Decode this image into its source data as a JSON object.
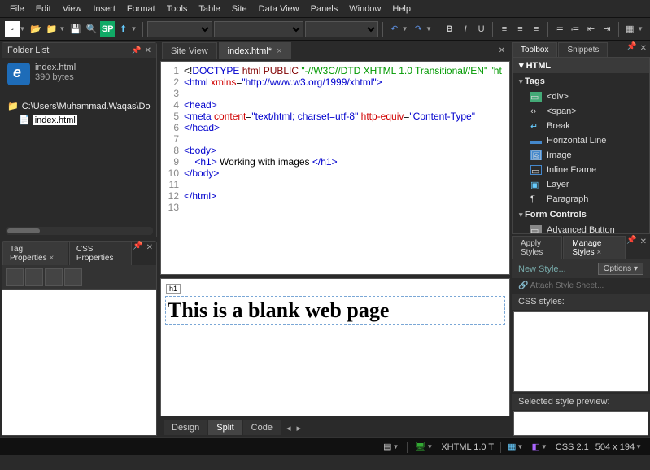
{
  "menu": [
    "File",
    "Edit",
    "View",
    "Insert",
    "Format",
    "Tools",
    "Table",
    "Site",
    "Data View",
    "Panels",
    "Window",
    "Help"
  ],
  "folder_panel": {
    "title": "Folder List",
    "file_name": "index.html",
    "file_size": "390 bytes",
    "path": "C:\\Users\\Muhammad.Waqas\\Documents\\M",
    "selected_file": "index.html"
  },
  "tag_panel": {
    "tab1": "Tag Properties",
    "tab2": "CSS Properties"
  },
  "doc_tabs": {
    "tab1": "Site View",
    "tab2": "index.html*"
  },
  "code_lines": [
    "<!DOCTYPE html PUBLIC \"-//W3C//DTD XHTML 1.0 Transitional//EN\" \"ht",
    "<html xmlns=\"http://www.w3.org/1999/xhtml\">",
    "",
    "<head>",
    "<meta content=\"text/html; charset=utf-8\" http-equiv=\"Content-Type\"",
    "</head>",
    "",
    "<body>",
    "    <h1> Working with images </h1>",
    "</body>",
    "",
    "</html>",
    ""
  ],
  "preview": {
    "breadcrumb": "h1",
    "heading": "This is a blank web page"
  },
  "view_tabs": [
    "Design",
    "Split",
    "Code"
  ],
  "toolbox": {
    "tab1": "Toolbox",
    "tab2": "Snippets",
    "html_head": "HTML",
    "tags_head": "Tags",
    "tags": [
      "<div>",
      "<span>",
      "Break",
      "Horizontal Line",
      "Image",
      "Inline Frame",
      "Layer",
      "Paragraph"
    ],
    "form_head": "Form Controls",
    "form_items": [
      "Advanced Button"
    ]
  },
  "styles": {
    "tab1": "Apply Styles",
    "tab2": "Manage Styles",
    "newstyle": "New Style...",
    "options": "Options",
    "attach": "Attach Style Sheet...",
    "css_label": "CSS styles:",
    "preview_label": "Selected style preview:"
  },
  "status": {
    "doctype": "XHTML 1.0 T",
    "css": "CSS 2.1",
    "dims": "504 x 194"
  }
}
